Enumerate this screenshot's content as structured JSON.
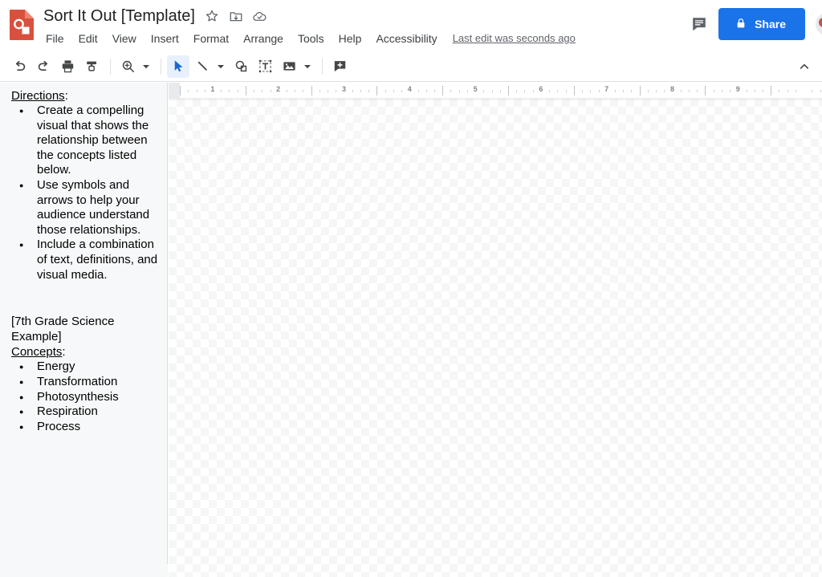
{
  "app": {
    "logo_icon": "google-drawings-logo",
    "title": "Sort It Out [Template]",
    "star_icon": "star-icon",
    "move_folder_icon": "move-to-folder-icon",
    "cloud_icon": "cloud-saved-icon"
  },
  "menubar": {
    "items": [
      {
        "label": "File"
      },
      {
        "label": "Edit"
      },
      {
        "label": "View"
      },
      {
        "label": "Insert"
      },
      {
        "label": "Format"
      },
      {
        "label": "Arrange"
      },
      {
        "label": "Tools"
      },
      {
        "label": "Help"
      },
      {
        "label": "Accessibility"
      }
    ],
    "last_edit": "Last edit was seconds ago"
  },
  "header_right": {
    "comment_icon": "comment-icon",
    "share_label": "Share",
    "share_lock_icon": "lock-icon",
    "share_color": "#1a73e8",
    "avatar": "user-avatar"
  },
  "toolbar": {
    "collapse_icon": "chevron-up-icon",
    "tools": [
      {
        "name": "undo-button",
        "icon": "undo-icon",
        "active": false,
        "caret": false
      },
      {
        "name": "redo-button",
        "icon": "redo-icon",
        "active": false,
        "caret": false
      },
      {
        "name": "print-button",
        "icon": "print-icon",
        "active": false,
        "caret": false
      },
      {
        "name": "paint-format-button",
        "icon": "paint-roller-icon",
        "active": false,
        "caret": false
      },
      {
        "name": "zoom-button",
        "icon": "zoom-in-icon",
        "active": false,
        "caret": true
      },
      {
        "name": "select-tool-button",
        "icon": "cursor-arrow-icon",
        "active": true,
        "caret": false
      },
      {
        "name": "line-tool-button",
        "icon": "line-icon",
        "active": false,
        "caret": true
      },
      {
        "name": "shape-tool-button",
        "icon": "shape-icon",
        "active": false,
        "caret": false
      },
      {
        "name": "text-box-button",
        "icon": "text-box-icon",
        "active": false,
        "caret": false
      },
      {
        "name": "image-tool-button",
        "icon": "image-icon",
        "active": false,
        "caret": true
      },
      {
        "name": "add-comment-button",
        "icon": "add-comment-icon",
        "active": false,
        "caret": false
      }
    ]
  },
  "ruler": {
    "unit": "inch",
    "numbers": [
      1,
      2,
      3,
      4,
      5,
      6,
      7,
      8,
      9
    ]
  },
  "sidebar": {
    "directions_heading": "Directions",
    "directions_colon": ":",
    "directions_items": [
      "Create a compelling visual that shows the relationship between the concepts listed below.",
      "Use symbols and arrows to help your audience understand those relationships.",
      "Include a combination of text, definitions, and visual media."
    ],
    "example_label": "[7th Grade Science Example]",
    "concepts_heading": "Concepts",
    "concepts_colon": ":",
    "concepts_items": [
      "Energy",
      "Transformation",
      "Photosynthesis",
      "Respiration",
      "Process"
    ]
  },
  "canvas": {
    "name": "drawing-canvas",
    "state": "empty-transparent"
  }
}
